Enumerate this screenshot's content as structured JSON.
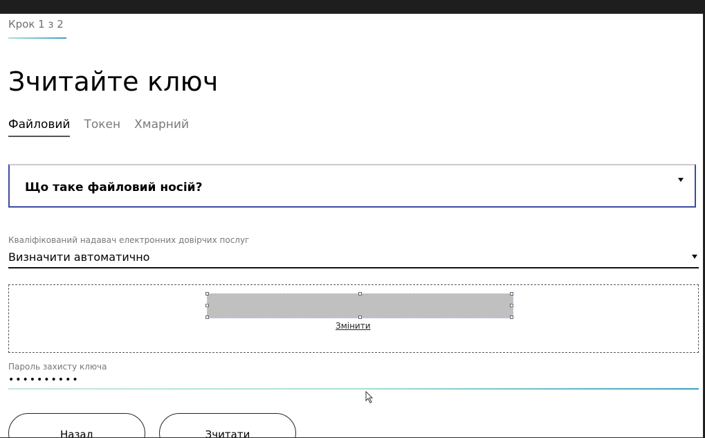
{
  "header": {
    "step": "Крок 1 з 2",
    "title": "Зчитайте ключ"
  },
  "tabs": [
    {
      "label": "Файловий",
      "active": true
    },
    {
      "label": "Токен",
      "active": false
    },
    {
      "label": "Хмарний",
      "active": false
    }
  ],
  "faq": {
    "label": "Що таке файловий носій?",
    "icon": "caret-down-icon"
  },
  "provider": {
    "label": "Кваліфікований надавач електронних довірчих послуг",
    "value": "Визначити автоматично",
    "icon": "caret-down-icon"
  },
  "file": {
    "change_label": "Змінити"
  },
  "password": {
    "label": "Пароль захисту ключа",
    "value": "••••••••••"
  },
  "buttons": {
    "back": "Назад",
    "read": "Зчитати"
  },
  "colors": {
    "accent_border": "#3b4aa0",
    "gradient_start": "#a6e2d1",
    "gradient_end": "#3aa0c0",
    "placeholder_gray": "#c0c0c0"
  }
}
